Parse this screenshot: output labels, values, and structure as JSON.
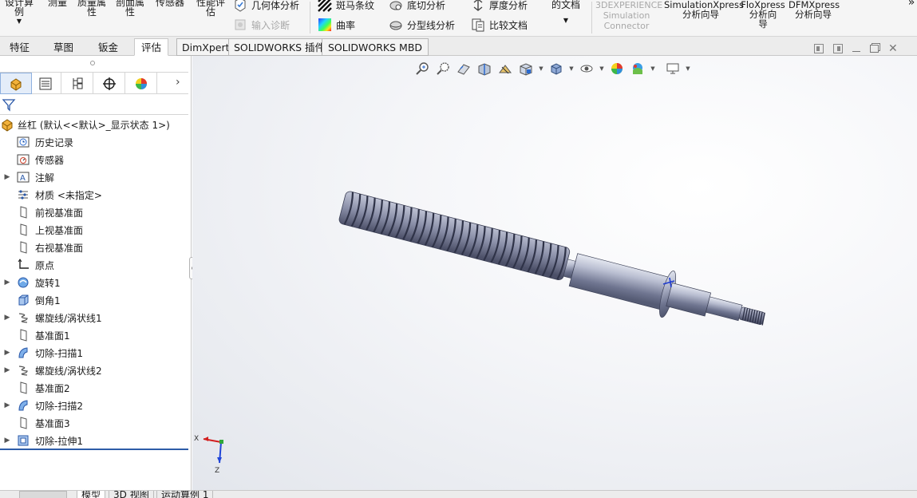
{
  "ribbon": {
    "design_study_label": "设计算\n例",
    "measure_label": "测量",
    "mass_props_label": "质量属\n性",
    "section_props_label": "剖面属\n性",
    "sensor_label": "传感器",
    "perf_eval_label": "性能评\n估",
    "geometry_analysis_label": "几何体分析",
    "input_diagnostics_label": "输入诊断",
    "zebra_label": "斑马条纹",
    "curvature_label": "曲率",
    "undercut_label": "底切分析",
    "parting_line_label": "分型线分析",
    "thickness_label": "厚度分析",
    "compare_docs_label": "比较文档",
    "check_active_doc_label": "检查激活\n的文档",
    "exp_sim_connector_label": "3DEXPERIENCE\nSimulation\nConnector",
    "simxpress_label": "SimulationXpress\n分析向导",
    "floxpress_label": "FloXpress\n分析向\n导",
    "dfmxpress_label": "DFMXpress\n分析向导",
    "overflow_label": "»"
  },
  "tabs": [
    {
      "label": "特征"
    },
    {
      "label": "草图"
    },
    {
      "label": "钣金"
    },
    {
      "label": "评估"
    },
    {
      "label": "DimXpert"
    },
    {
      "label": "SOLIDWORKS 插件"
    },
    {
      "label": "SOLIDWORKS MBD"
    }
  ],
  "tree": {
    "root": "丝杠  (默认<<默认>_显示状态 1>)",
    "items": [
      {
        "label": "历史记录",
        "icon": "history-icon",
        "expandable": false
      },
      {
        "label": "传感器",
        "icon": "sensor-icon",
        "expandable": false
      },
      {
        "label": "注解",
        "icon": "annotation-icon",
        "expandable": true
      },
      {
        "label": "材质 <未指定>",
        "icon": "material-icon",
        "expandable": false
      },
      {
        "label": "前视基准面",
        "icon": "plane-icon",
        "expandable": false
      },
      {
        "label": "上视基准面",
        "icon": "plane-icon",
        "expandable": false
      },
      {
        "label": "右视基准面",
        "icon": "plane-icon",
        "expandable": false
      },
      {
        "label": "原点",
        "icon": "origin-icon",
        "expandable": false
      },
      {
        "label": "旋转1",
        "icon": "revolve-icon",
        "expandable": true
      },
      {
        "label": "倒角1",
        "icon": "chamfer-icon",
        "expandable": false
      },
      {
        "label": "螺旋线/涡状线1",
        "icon": "helix-icon",
        "expandable": true
      },
      {
        "label": "基准面1",
        "icon": "plane-icon",
        "expandable": false
      },
      {
        "label": "切除-扫描1",
        "icon": "sweep-cut-icon",
        "expandable": true
      },
      {
        "label": "螺旋线/涡状线2",
        "icon": "helix-icon",
        "expandable": true
      },
      {
        "label": "基准面2",
        "icon": "plane-icon",
        "expandable": false
      },
      {
        "label": "切除-扫描2",
        "icon": "sweep-cut-icon",
        "expandable": true
      },
      {
        "label": "基准面3",
        "icon": "plane-icon",
        "expandable": false
      },
      {
        "label": "切除-拉伸1",
        "icon": "extrude-cut-icon",
        "expandable": true
      }
    ]
  },
  "triad": {
    "x_label": "X",
    "z_label": "Z"
  },
  "bottom_tabs": [
    {
      "label": "模型"
    },
    {
      "label": "3D 视图"
    },
    {
      "label": "运动算例 1"
    }
  ]
}
